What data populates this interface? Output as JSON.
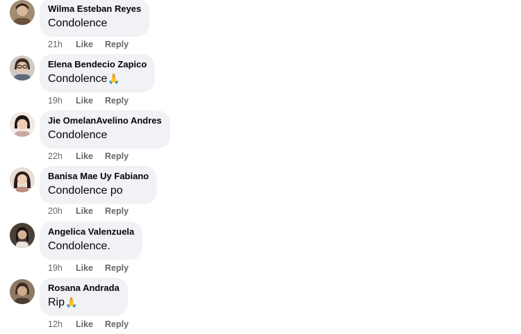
{
  "comments": [
    {
      "author": "Wilma Esteban Reyes",
      "text": "Condolence",
      "emoji": "",
      "time": "21h",
      "like_label": "Like",
      "reply_label": "Reply"
    },
    {
      "author": "Elena Bendecio Zapico",
      "text": "Condolence",
      "emoji": "🙏",
      "time": "19h",
      "like_label": "Like",
      "reply_label": "Reply"
    },
    {
      "author": "Jie OmelanAvelino Andres",
      "text": "Condolence",
      "emoji": "",
      "time": "22h",
      "like_label": "Like",
      "reply_label": "Reply"
    },
    {
      "author": "Banisa Mae Uy Fabiano",
      "text": "Condolence po",
      "emoji": "",
      "time": "20h",
      "like_label": "Like",
      "reply_label": "Reply"
    },
    {
      "author": "Angelica Valenzuela",
      "text": "Condolence.",
      "emoji": "",
      "time": "19h",
      "like_label": "Like",
      "reply_label": "Reply"
    },
    {
      "author": "Rosana Andrada",
      "text": "Rip",
      "emoji": "🙏",
      "time": "12h",
      "like_label": "Like",
      "reply_label": "Reply"
    }
  ],
  "colors": {
    "bubble": "#f0f2f5",
    "author_text": "#050505",
    "meta_text": "#65676b"
  }
}
